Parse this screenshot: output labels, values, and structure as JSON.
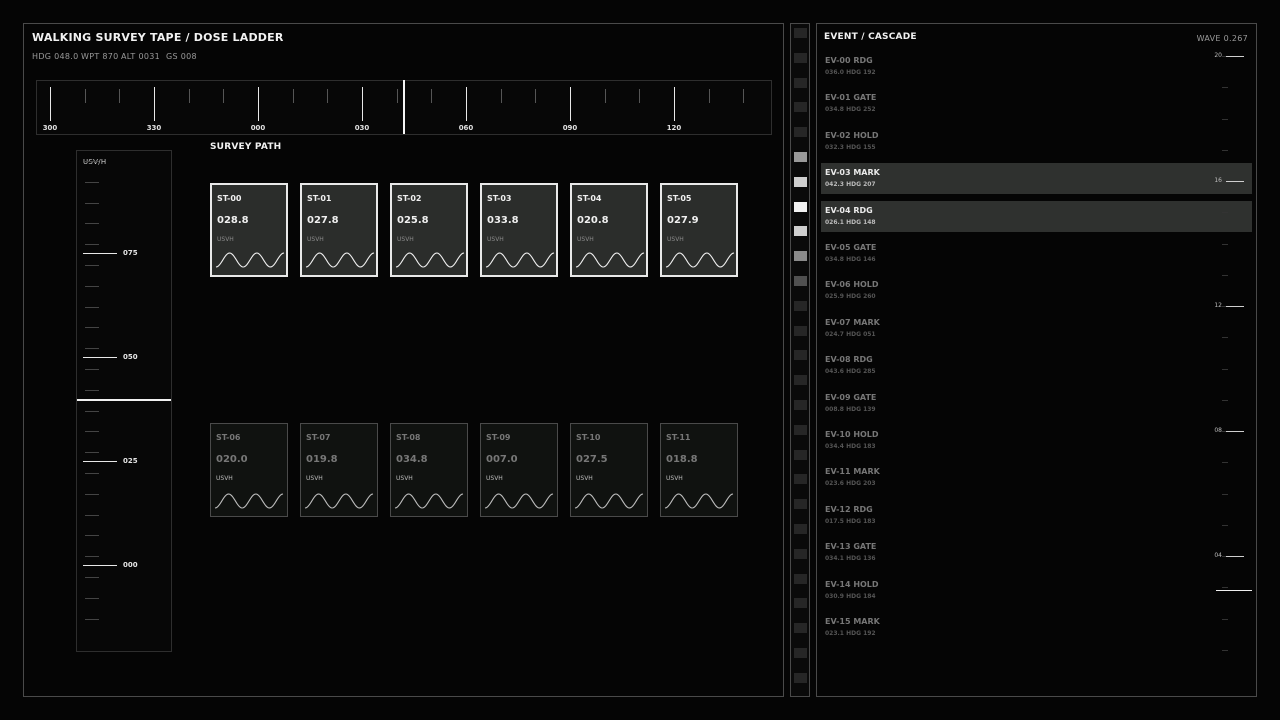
{
  "header": {
    "title": "WALKING SURVEY TAPE / DOSE LADDER",
    "readouts": [
      "HDG 048.0",
      "WPT 870",
      "ALT 0031",
      "GS 008"
    ]
  },
  "tape": {
    "labels": [
      "300",
      "330",
      "000",
      "030",
      "060",
      "090",
      "120"
    ]
  },
  "ladder": {
    "unit": "USV/H",
    "labels": [
      "075",
      "050",
      "025",
      "000"
    ]
  },
  "survey": {
    "title": "SURVEY PATH",
    "stations": [
      {
        "id": "ST-00",
        "value": "028.8",
        "unit": "USVH",
        "active": true
      },
      {
        "id": "ST-01",
        "value": "027.8",
        "unit": "USVH",
        "active": true
      },
      {
        "id": "ST-02",
        "value": "025.8",
        "unit": "USVH",
        "active": true
      },
      {
        "id": "ST-03",
        "value": "033.8",
        "unit": "USVH",
        "active": true
      },
      {
        "id": "ST-04",
        "value": "020.8",
        "unit": "USVH",
        "active": true
      },
      {
        "id": "ST-05",
        "value": "027.9",
        "unit": "USVH",
        "active": true
      },
      {
        "id": "ST-06",
        "value": "020.0",
        "unit": "USVH",
        "active": false
      },
      {
        "id": "ST-07",
        "value": "019.8",
        "unit": "USVH",
        "active": false
      },
      {
        "id": "ST-08",
        "value": "034.8",
        "unit": "USVH",
        "active": false
      },
      {
        "id": "ST-09",
        "value": "007.0",
        "unit": "USVH",
        "active": false
      },
      {
        "id": "ST-10",
        "value": "027.5",
        "unit": "USVH",
        "active": false
      },
      {
        "id": "ST-11",
        "value": "018.8",
        "unit": "USVH",
        "active": false
      }
    ]
  },
  "events": {
    "title": "EVENT / CASCADE",
    "wave": "WAVE 0.267",
    "items": [
      {
        "name": "EV-00 RDG",
        "meta": "036.0 HDG 192",
        "highlight": false
      },
      {
        "name": "EV-01 GATE",
        "meta": "034.8 HDG 252",
        "highlight": false
      },
      {
        "name": "EV-02 HOLD",
        "meta": "032.3 HDG 155",
        "highlight": false
      },
      {
        "name": "EV-03 MARK",
        "meta": "042.3 HDG 207",
        "highlight": true
      },
      {
        "name": "EV-04 RDG",
        "meta": "026.1 HDG 148",
        "highlight": true
      },
      {
        "name": "EV-05 GATE",
        "meta": "034.8 HDG 146",
        "highlight": false
      },
      {
        "name": "EV-06 HOLD",
        "meta": "025.9 HDG 260",
        "highlight": false
      },
      {
        "name": "EV-07 MARK",
        "meta": "024.7 HDG 051",
        "highlight": false
      },
      {
        "name": "EV-08 RDG",
        "meta": "043.6 HDG 285",
        "highlight": false
      },
      {
        "name": "EV-09 GATE",
        "meta": "008.8 HDG 139",
        "highlight": false
      },
      {
        "name": "EV-10 HOLD",
        "meta": "034.4 HDG 183",
        "highlight": false
      },
      {
        "name": "EV-11 MARK",
        "meta": "023.6 HDG 203",
        "highlight": false
      },
      {
        "name": "EV-12 RDG",
        "meta": "017.5 HDG 183",
        "highlight": false
      },
      {
        "name": "EV-13 GATE",
        "meta": "034.1 HDG 136",
        "highlight": false
      },
      {
        "name": "EV-14 HOLD",
        "meta": "030.9 HDG 184",
        "highlight": false
      },
      {
        "name": "EV-15 MARK",
        "meta": "023.1 HDG 192",
        "highlight": false
      }
    ],
    "scale_labels": [
      "20",
      "16",
      "12",
      "08",
      "04"
    ]
  },
  "colors": {
    "background": "#050505",
    "panel_border": "#4a4a4a",
    "active_card": "#2b2d2b",
    "highlight_row": "#2f312f",
    "accent": "#f0f0f0"
  }
}
